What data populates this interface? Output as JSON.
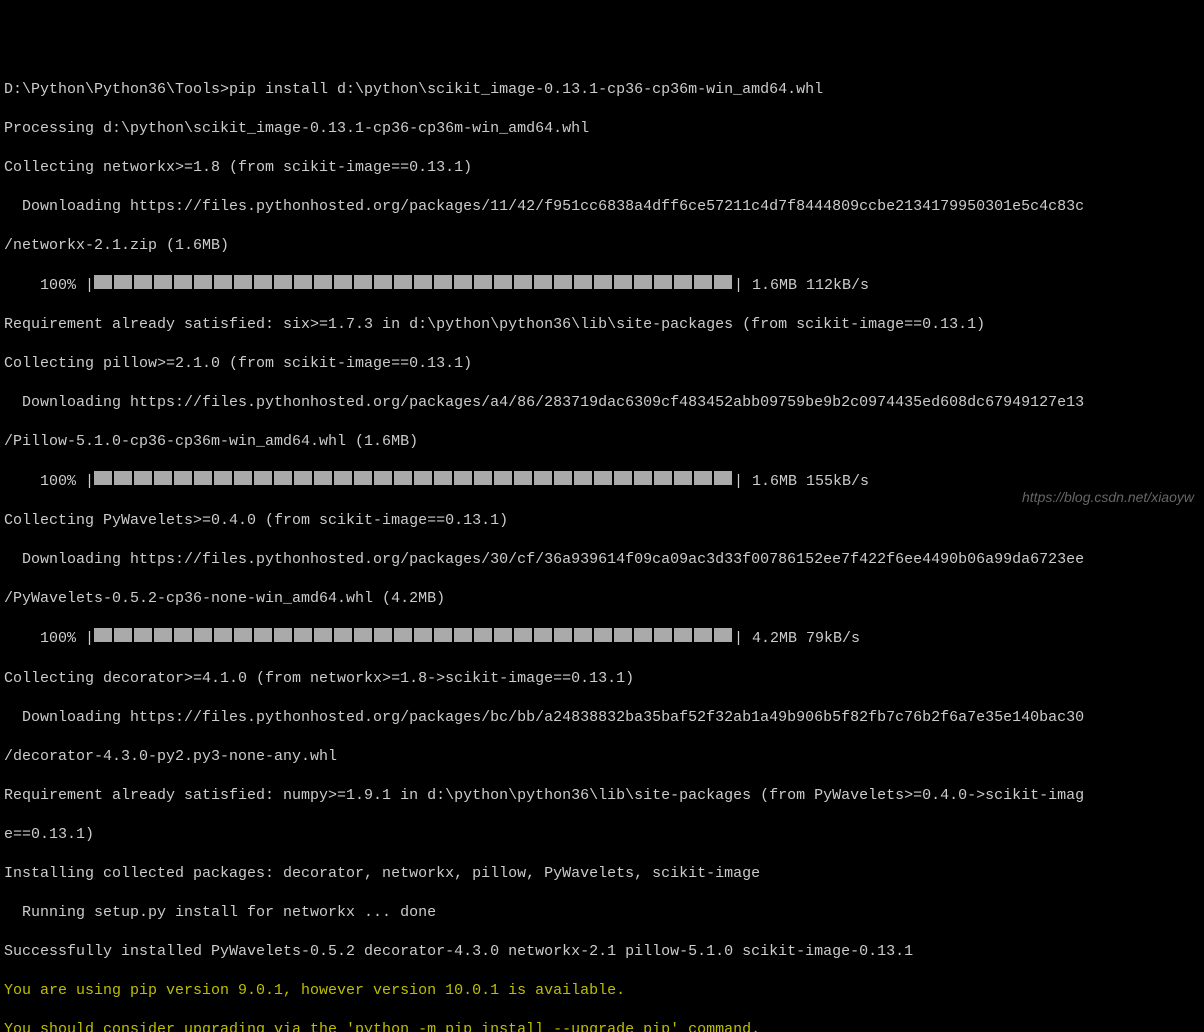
{
  "lines": {
    "cmd": "D:\\Python\\Python36\\Tools>pip install d:\\python\\scikit_image-0.13.1-cp36-cp36m-win_amd64.whl",
    "processing": "Processing d:\\python\\scikit_image-0.13.1-cp36-cp36m-win_amd64.whl",
    "collect_networkx": "Collecting networkx>=1.8 (from scikit-image==0.13.1)",
    "download_networkx": "  Downloading https://files.pythonhosted.org/packages/11/42/f951cc6838a4dff6ce57211c4d7f8444809ccbe2134179950301e5c4c83c",
    "networkx_file": "/networkx-2.1.zip (1.6MB)",
    "progress1_label": "    100% |",
    "progress1_stats": "| 1.6MB 112kB/s",
    "req_six": "Requirement already satisfied: six>=1.7.3 in d:\\python\\python36\\lib\\site-packages (from scikit-image==0.13.1)",
    "collect_pillow": "Collecting pillow>=2.1.0 (from scikit-image==0.13.1)",
    "download_pillow": "  Downloading https://files.pythonhosted.org/packages/a4/86/283719dac6309cf483452abb09759be9b2c0974435ed608dc67949127e13",
    "pillow_file": "/Pillow-5.1.0-cp36-cp36m-win_amd64.whl (1.6MB)",
    "progress2_label": "    100% |",
    "progress2_stats": "| 1.6MB 155kB/s",
    "collect_pywavelets": "Collecting PyWavelets>=0.4.0 (from scikit-image==0.13.1)",
    "download_pywavelets": "  Downloading https://files.pythonhosted.org/packages/30/cf/36a939614f09ca09ac3d33f00786152ee7f422f6ee4490b06a99da6723ee",
    "pywavelets_file": "/PyWavelets-0.5.2-cp36-none-win_amd64.whl (4.2MB)",
    "progress3_label": "    100% |",
    "progress3_stats": "| 4.2MB 79kB/s",
    "collect_decorator": "Collecting decorator>=4.1.0 (from networkx>=1.8->scikit-image==0.13.1)",
    "download_decorator": "  Downloading https://files.pythonhosted.org/packages/bc/bb/a24838832ba35baf52f32ab1a49b906b5f82fb7c76b2f6a7e35e140bac30",
    "decorator_file": "/decorator-4.3.0-py2.py3-none-any.whl",
    "req_numpy": "Requirement already satisfied: numpy>=1.9.1 in d:\\python\\python36\\lib\\site-packages (from PyWavelets>=0.4.0->scikit-imag",
    "req_numpy2": "e==0.13.1)",
    "installing": "Installing collected packages: decorator, networkx, pillow, PyWavelets, scikit-image",
    "running_setup": "  Running setup.py install for networkx ... done",
    "success": "Successfully installed PyWavelets-0.5.2 decorator-4.3.0 networkx-2.1 pillow-5.1.0 scikit-image-0.13.1",
    "warn1": "You are using pip version 9.0.1, however version 10.0.1 is available.",
    "warn2": "You should consider upgrading via the 'python -m pip install --upgrade pip' command."
  },
  "progress_blocks": 32,
  "watermark": "https://blog.csdn.net/xiaoyw"
}
